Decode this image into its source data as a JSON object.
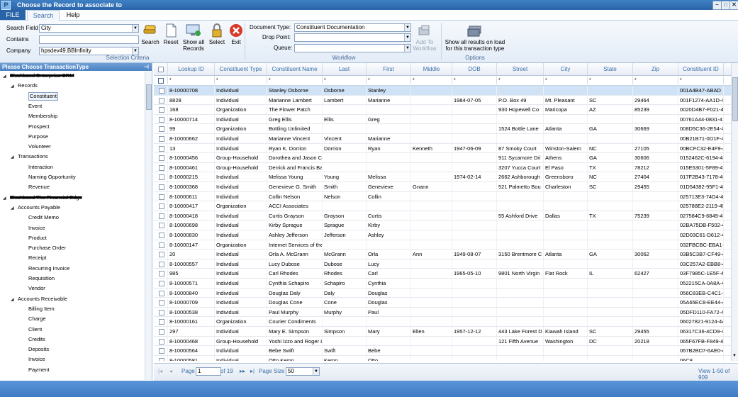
{
  "window": {
    "title": "Choose the Record to associate to",
    "app_icon": "P"
  },
  "menu": {
    "file": "FILE",
    "tabs": [
      "Search",
      "Help"
    ]
  },
  "selection_criteria": {
    "search_field_label": "Search Field",
    "search_field_value": "City",
    "contains_label": "Contains",
    "contains_value": "",
    "company_label": "Company",
    "company_value": "hpsdev49.BBInfinity",
    "caption": "Selection Criteria",
    "buttons": [
      "Search",
      "Reset",
      "Show all Records",
      "Select",
      "Exit"
    ]
  },
  "workflow": {
    "document_type_label": "Document Type:",
    "document_type_value": "Constituent Documentation",
    "drop_point_label": "Drop Point:",
    "drop_point_value": "",
    "queue_label": "Queue:",
    "queue_value": "",
    "add_to_workflow": "Add To Workflow",
    "caption": "Workflow"
  },
  "options": {
    "show_all_on_load": "Show all results on load for this transaction type",
    "caption": "Options"
  },
  "left_panel": {
    "title": "Please Choose TransactionType",
    "tree": [
      {
        "level": 0,
        "label": "Blackbaud Enterprise CRM",
        "redacted": true,
        "expanded": true
      },
      {
        "level": 1,
        "label": "Records",
        "expanded": true
      },
      {
        "level": 2,
        "label": "Constituent",
        "selected": true
      },
      {
        "level": 2,
        "label": "Event"
      },
      {
        "level": 2,
        "label": "Membership"
      },
      {
        "level": 2,
        "label": "Prospect"
      },
      {
        "level": 2,
        "label": "Purpose"
      },
      {
        "level": 2,
        "label": "Volunteer"
      },
      {
        "level": 1,
        "label": "Transactions",
        "expanded": true
      },
      {
        "level": 2,
        "label": "Interaction"
      },
      {
        "level": 2,
        "label": "Naming Opportunity"
      },
      {
        "level": 2,
        "label": "Revenue"
      },
      {
        "level": 0,
        "label": "Blackbaud The Financial Edge",
        "redacted": true,
        "expanded": true
      },
      {
        "level": 1,
        "label": "Accounts Payable",
        "expanded": true
      },
      {
        "level": 2,
        "label": "Credit Memo"
      },
      {
        "level": 2,
        "label": "Invoice"
      },
      {
        "level": 2,
        "label": "Product"
      },
      {
        "level": 2,
        "label": "Purchase Order"
      },
      {
        "level": 2,
        "label": "Receipt"
      },
      {
        "level": 2,
        "label": "Recurring Invoice"
      },
      {
        "level": 2,
        "label": "Requisition"
      },
      {
        "level": 2,
        "label": "Vendor"
      },
      {
        "level": 1,
        "label": "Accounts Receivable",
        "expanded": true
      },
      {
        "level": 2,
        "label": "Billing Item"
      },
      {
        "level": 2,
        "label": "Charge"
      },
      {
        "level": 2,
        "label": "Client"
      },
      {
        "level": 2,
        "label": "Credits"
      },
      {
        "level": 2,
        "label": "Deposits"
      },
      {
        "level": 2,
        "label": "Invoice"
      },
      {
        "level": 2,
        "label": "Payment"
      }
    ]
  },
  "grid": {
    "columns": [
      "Lookup ID",
      "Constituent Type",
      "Constituent Name",
      "Last",
      "First",
      "Middle",
      "DOB",
      "Street",
      "City",
      "State",
      "Zip",
      "Constituent ID"
    ],
    "filter_symbol": "*",
    "rows": [
      [
        "8-10000708",
        "Individual",
        "Stanley Osborne",
        "Osborne",
        "Stanley",
        "",
        "",
        "",
        "",
        "",
        "",
        "001A4B47-ABAD"
      ],
      [
        "8828",
        "Individual",
        "Marianne Lambert",
        "Lambert",
        "Marianne",
        "",
        "1984-07-05",
        "P.O. Box 49",
        "Mt. Pleasant",
        "SC",
        "29464",
        "001F1274-AA1D-4"
      ],
      [
        "168",
        "Organization",
        "The Flower Patch",
        "",
        "",
        "",
        "",
        "930 Hopewell Co",
        "Maricopa",
        "AZ",
        "85239",
        "0020D4B7-F021-4F"
      ],
      [
        "8-10000714",
        "Individual",
        "Greg Ellis",
        "Ellis",
        "Greg",
        "",
        "",
        "",
        "",
        "",
        "",
        "00761A44-0831-4"
      ],
      [
        "99",
        "Organization",
        "Bottling Unlimited",
        "",
        "",
        "",
        "",
        "1524 Bottle Lane",
        "Atlanta",
        "GA",
        "30669",
        "008D5C36-2E54-4"
      ],
      [
        "8-10000662",
        "Individual",
        "Marianne Vincent",
        "Vincent",
        "Marianne",
        "",
        "",
        "",
        "",
        "",
        "",
        "00B21B71-0D1F-4"
      ],
      [
        "13",
        "Individual",
        "Ryan K. Dorrion",
        "Dorrion",
        "Ryan",
        "Kenneth",
        "1947-06-09",
        "87 Smoky Court",
        "Winston-Salem",
        "NC",
        "27105",
        "00BCFC32-E4F9-41"
      ],
      [
        "8-10000456",
        "Group-Household",
        "Dorothea and Jason Ca",
        "",
        "",
        "",
        "",
        "911 Sycamore Dri",
        "Athens",
        "GA",
        "30606",
        "0152462C-6194-48"
      ],
      [
        "8-10000461",
        "Group-Household",
        "Derrick and Francis Bak",
        "",
        "",
        "",
        "",
        "3207 Yucca Court",
        "El Paso",
        "TX",
        "78212",
        "015E5301-5F89-41"
      ],
      [
        "8-10000215",
        "Individual",
        "Melissa Young",
        "Young",
        "Melissa",
        "",
        "1974-02-14",
        "2662 Ashborough",
        "Greensboro",
        "NC",
        "27404",
        "017F2B43-7178-40"
      ],
      [
        "8-10000368",
        "Individual",
        "Genevieve G. Smith",
        "Smith",
        "Genevieve",
        "Gnann",
        "",
        "521 Palmetto Bou",
        "Charleston",
        "SC",
        "29455",
        "01D54382-95F1-43"
      ],
      [
        "8-10000611",
        "Individual",
        "Collin Nelson",
        "Nelson",
        "Collin",
        "",
        "",
        "",
        "",
        "",
        "",
        "025713E3-74D4-4"
      ],
      [
        "8-10000417",
        "Organization",
        "ACCI Associates",
        "",
        "",
        "",
        "",
        "",
        "",
        "",
        "",
        "025788E2-2119-49"
      ],
      [
        "8-10000418",
        "Individual",
        "Curtis Grayson",
        "Grayson",
        "Curtis",
        "",
        "",
        "55 Ashford Drive",
        "Dallas",
        "TX",
        "75239",
        "027584C9-6849-4E"
      ],
      [
        "8-10000698",
        "Individual",
        "Kirby Sprague",
        "Sprague",
        "Kirby",
        "",
        "",
        "",
        "",
        "",
        "",
        "02BA75DB-F502-4"
      ],
      [
        "8-10000830",
        "Individual",
        "Ashley Jefferson",
        "Jefferson",
        "Ashley",
        "",
        "",
        "",
        "",
        "",
        "",
        "02D03C61-D612-4"
      ],
      [
        "8-10000147",
        "Organization",
        "Internet Services of the",
        "",
        "",
        "",
        "",
        "",
        "",
        "",
        "",
        "032FBCBC-EBA1-4"
      ],
      [
        "20",
        "Individual",
        "Orla A. McGrann",
        "McGrann",
        "Orla",
        "Ann",
        "1949-08-07",
        "3150 Brentmore C",
        "Atlanta",
        "GA",
        "30062",
        "03B5C3B7-CF49-4"
      ],
      [
        "8-10000557",
        "Individual",
        "Lucy Dubose",
        "Dubose",
        "Lucy",
        "",
        "",
        "",
        "",
        "",
        "",
        "03C257A2-EBB8-4"
      ],
      [
        "985",
        "Individual",
        "Carl Rhodes",
        "Rhodes",
        "Carl",
        "",
        "1965-05-10",
        "9801 North Virgin",
        "Flat Rock",
        "IL",
        "62427",
        "03F7985C-1E5F-49"
      ],
      [
        "8-10000571",
        "Individual",
        "Cynthia Schapiro",
        "Schapiro",
        "Cynthia",
        "",
        "",
        "",
        "",
        "",
        "",
        "052215CA-0A8A-4"
      ],
      [
        "8-10000840",
        "Individual",
        "Douglas Daly",
        "Daly",
        "Douglas",
        "",
        "",
        "",
        "",
        "",
        "",
        "056C83EB-C4C1-4"
      ],
      [
        "8-10000709",
        "Individual",
        "Douglas Cone",
        "Cone",
        "Douglas",
        "",
        "",
        "",
        "",
        "",
        "",
        "05A65EC8-EE44-4"
      ],
      [
        "8-10000538",
        "Individual",
        "Paul Murphy",
        "Murphy",
        "Paul",
        "",
        "",
        "",
        "",
        "",
        "",
        "05DFD110-FA72-4"
      ],
      [
        "8-10000161",
        "Organization",
        "Courier Condiments",
        "",
        "",
        "",
        "",
        "",
        "",
        "",
        "",
        "06027821-9124-4A"
      ],
      [
        "297",
        "Individual",
        "Mary E. Simpson",
        "Simpson",
        "Mary",
        "Ellen",
        "1957-12-12",
        "443 Lake Forest D",
        "Kiawah Island",
        "SC",
        "29455",
        "06317C36-4CD9-4"
      ],
      [
        "8-10000468",
        "Group-Household",
        "Yoshi Izzo and Roger L",
        "",
        "",
        "",
        "",
        "121 Fifth Avenue",
        "Washington",
        "DC",
        "20218",
        "065F67FB-F849-45"
      ],
      [
        "8-10000564",
        "Individual",
        "Bebe Swift",
        "Swift",
        "Bebe",
        "",
        "",
        "",
        "",
        "",
        "",
        "067B2BD7-6AE0-4"
      ],
      [
        "8-10000581",
        "Individual",
        "Otto Kemp",
        "Kemp",
        "Otto",
        "",
        "",
        "",
        "",
        "",
        "",
        "06C8..."
      ]
    ]
  },
  "pager": {
    "page_label": "Page",
    "page_value": "1",
    "of_label": "of 19",
    "page_size_label": "Page Size :",
    "page_size_value": "50",
    "view_info": "View 1-50 of 909"
  },
  "colors": {
    "accent": "#2a64a8",
    "selected_row": "#cfe2f6",
    "header_text": "#3a6ea8"
  }
}
